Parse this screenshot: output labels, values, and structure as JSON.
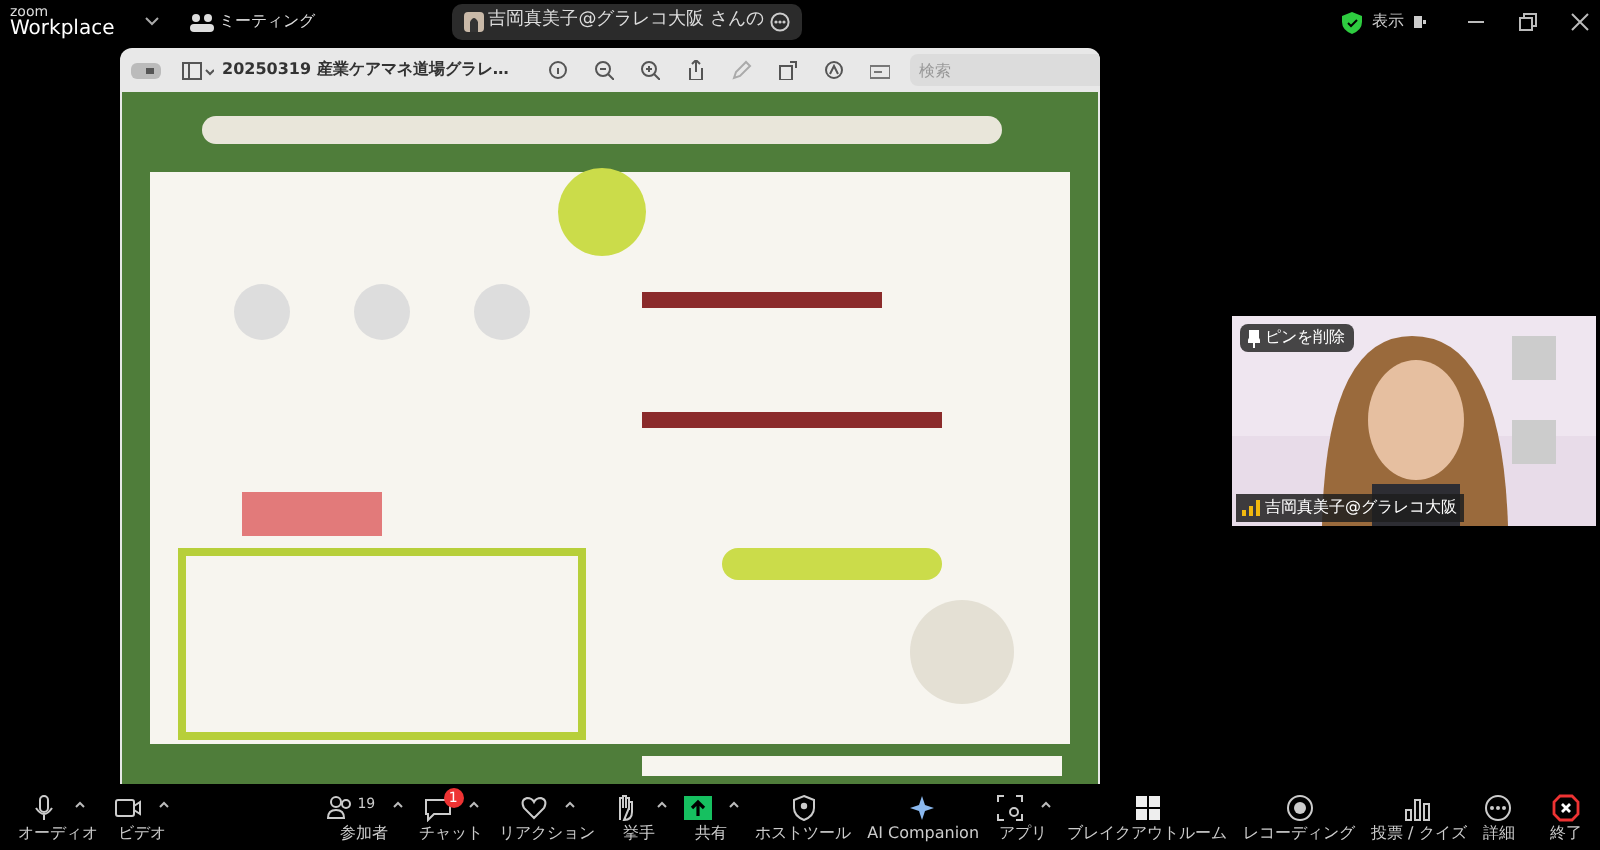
{
  "top_bar": {
    "logo": [
      "zoom",
      "Workplace"
    ],
    "meeting_menu": "ミーティング",
    "share_pill": "吉岡真美子@グラレコ大阪 さんの",
    "view_button": "表示"
  },
  "viewer": {
    "title": "20250319 産業ケアマネ道場グラレ…",
    "search": {
      "placeholder": "検索"
    }
  },
  "video_tile": {
    "pin_button": "ピンを削除",
    "participant_name": "吉岡真美子@グラレコ大阪"
  },
  "toolbar": [
    {
      "label": "オーディオ",
      "caret": true
    },
    {
      "label": "ビデオ",
      "caret": true
    },
    {
      "label": "参加者",
      "count": "19",
      "caret": true
    },
    {
      "label": "チャット",
      "badge": "1",
      "caret": true
    },
    {
      "label": "リアクション",
      "caret": true
    },
    {
      "label": "挙手",
      "caret": true
    },
    {
      "label": "共有",
      "caret": true
    },
    {
      "label": "ホストツール",
      "caret": false
    },
    {
      "label": "AI Companion",
      "caret": false
    },
    {
      "label": "アプリ",
      "caret": true
    },
    {
      "label": "ブレイクアウトルーム",
      "caret": false
    },
    {
      "label": "レコーディング",
      "caret": false
    },
    {
      "label": "投票 / クイズ",
      "caret": false
    },
    {
      "label": "詳細",
      "caret": false
    },
    {
      "label": "終了",
      "caret": false
    }
  ]
}
